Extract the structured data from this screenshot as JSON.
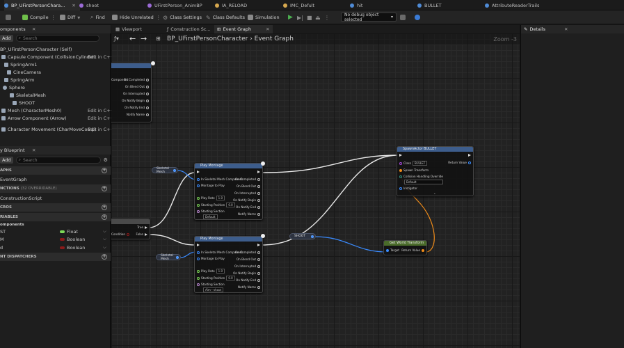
{
  "tabs": [
    {
      "label": "BP_UFirstPersonChara...",
      "color": "#4f8bd6",
      "active": true
    },
    {
      "label": "shoot",
      "color": "#9b6bd6"
    },
    {
      "label": "UFirstPerson_AnimBP",
      "color": "#9b6bd6"
    },
    {
      "label": "IA_RELOAD",
      "color": "#d6a84f"
    },
    {
      "label": "IMC_Defult",
      "color": "#d6a84f"
    },
    {
      "label": "hit",
      "color": "#4f8bd6"
    },
    {
      "label": "BULLET",
      "color": "#4f8bd6"
    },
    {
      "label": "AttributeReaderTrails",
      "color": "#4f8bd6"
    }
  ],
  "toolbar": {
    "compile": "Compile",
    "diff": "Diff",
    "find": "Find",
    "hide_unrelated": "Hide Unrelated",
    "class_settings": "Class Settings",
    "class_defaults": "Class Defaults",
    "simulation": "Simulation",
    "debug_object": "No debug object selected"
  },
  "components_panel": {
    "title": "omponents",
    "add": "Add",
    "search_placeholder": "Search",
    "items": [
      {
        "label": "BP_UFirstPersonCharacter (Self)",
        "edit": ""
      },
      {
        "label": "Capsule Component (CollisionCylinder)",
        "edit": "Edit in C++"
      },
      {
        "label": "SpringArm1",
        "edit": ""
      },
      {
        "label": "CineCamera",
        "edit": ""
      },
      {
        "label": "SpringArm",
        "edit": ""
      },
      {
        "label": "Sphere",
        "edit": ""
      },
      {
        "label": "SkeletalMesh",
        "edit": ""
      },
      {
        "label": "SHOOT",
        "edit": ""
      },
      {
        "label": "Mesh (CharacterMesh0)",
        "edit": "Edit in C++"
      },
      {
        "label": "Arrow Component (Arrow)",
        "edit": "Edit in C++"
      },
      {
        "label": "Character Movement (CharMoveComp)",
        "edit": "Edit in C++"
      }
    ]
  },
  "blueprint_panel": {
    "title": "y Blueprint",
    "add": "Add",
    "search_placeholder": "Search",
    "sections": {
      "graphs": "APHS",
      "event_graph": "EventGraph",
      "functions": "NCTIONS",
      "functions_overridable": "(32 OVERRIDABLE)",
      "construction": "ConstructionScript",
      "macros": "CROS",
      "variables": "RIABLES",
      "components": "omponents",
      "dispatchers": "NT DISPATCHERS"
    },
    "variables": [
      {
        "name": "ST",
        "type": "Float",
        "color": "#7ed957"
      },
      {
        "name": "M",
        "type": "Boolean",
        "color": "#8b1a1a"
      },
      {
        "name": "d",
        "type": "Boolean",
        "color": "#8b1a1a"
      }
    ]
  },
  "doc_tabs": [
    {
      "label": "Viewport"
    },
    {
      "label": "Construction Sc..."
    },
    {
      "label": "Event Graph",
      "active": true
    }
  ],
  "graph": {
    "breadcrumb_bp": "BP_UFirstPersonCharacter",
    "breadcrumb_graph": "Event Graph",
    "zoom": "Zoom -3",
    "nodes": {
      "left_partial": {
        "component_label": "Component",
        "pins": [
          "On Completed",
          "On Blend Out",
          "On Interrupted",
          "On Notify Begin",
          "On Notify End",
          "Notify Name"
        ]
      },
      "skeletal_mesh_1": "Skeletal Mesh",
      "skeletal_mesh_2": "Skeletal Mesh",
      "branch": {
        "condition": "Condition",
        "true": "True",
        "false": "False"
      },
      "montage_1": {
        "title": "Play Montage",
        "in_mesh": "In Skeletal Mesh Component",
        "montage": "Montage to Play",
        "play_rate": "Play Rate",
        "play_rate_val": "1.0",
        "start_pos": "Starting Position",
        "start_pos_val": "0.0",
        "section": "Starting Section",
        "section_val": "Default",
        "outs": [
          "On Completed",
          "On Blend Out",
          "On Interrupted",
          "On Notify Begin",
          "On Notify End",
          "Notify Name"
        ]
      },
      "montage_2": {
        "title": "Play Montage",
        "in_mesh": "In Skeletal Mesh Component",
        "montage": "Montage to Play",
        "play_rate": "Play Rate",
        "play_rate_val": "1.0",
        "start_pos": "Starting Position",
        "start_pos_val": "0.0",
        "section": "Starting Section",
        "section_val": "Aim---shoot",
        "outs": [
          "On Completed",
          "On Blend Out",
          "On Interrupted",
          "On Notify Begin",
          "On Notify End",
          "Notify Name"
        ]
      },
      "shoot_var": "SHOOT",
      "get_transform": {
        "title": "Get World Transform",
        "target": "Target",
        "return": "Return Value"
      },
      "spawn": {
        "title": "SpawnActor BULLET",
        "class": "Class",
        "class_val": "BULLET",
        "return": "Return Value",
        "spawn_transform": "Spawn Transform",
        "collision": "Collision Handling Override",
        "collision_val": "Default",
        "instigator": "Instigator"
      }
    }
  },
  "details": {
    "title": "Details"
  },
  "colors": {
    "exec": "#e0e0e0",
    "object_pin": "#3a8bff",
    "transform_pin": "#f08c1a",
    "montage_head": "#3d5d8c",
    "spawn_head": "#3d5d8c",
    "transform_head": "#4a6b2a"
  }
}
